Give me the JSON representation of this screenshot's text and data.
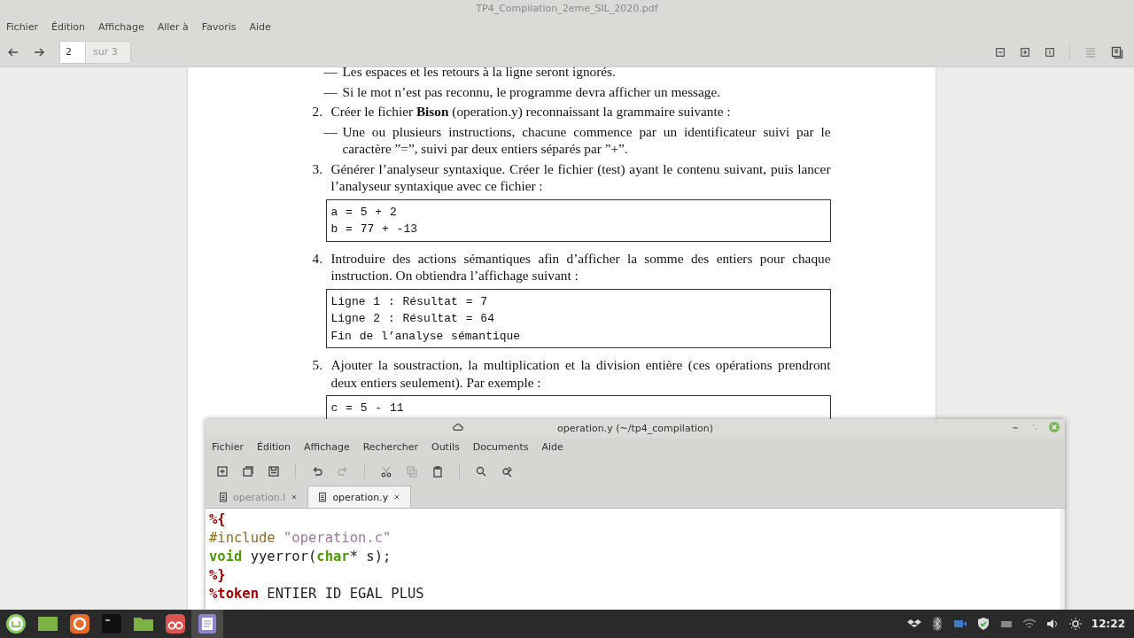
{
  "viewer": {
    "title": "TP4_Compilation_2eme_SIL_2020.pdf",
    "menu": [
      "Fichier",
      "Édition",
      "Affichage",
      "Aller à",
      "Favoris",
      "Aide"
    ],
    "page_number": "2",
    "page_total": "sur 3",
    "blocks": [
      {
        "kind": "dash",
        "marker": "—",
        "text": "Les espaces et les retours à la ligne seront ignorés."
      },
      {
        "kind": "dash",
        "marker": "—",
        "text": "Si le mot n’est pas reconnu, le programme devra afficher un message."
      },
      {
        "kind": "numbered",
        "marker": "2.",
        "text": "Créer le fichier **Bison** (operation.y) reconnaissant la grammaire suivante :"
      },
      {
        "kind": "dash",
        "marker": "—",
        "text": "Une ou plusieurs instructions, chacune commence par un identificateur suivi par le caractère ”=”, suivi par deux entiers séparés par ”+”."
      },
      {
        "kind": "numbered",
        "marker": "3.",
        "text": "Générer l’analyseur syntaxique. Créer le fichier (test) ayant le contenu suivant, puis lancer l’analyseur syntaxique avec ce fichier :"
      },
      {
        "kind": "code",
        "lines": [
          "a = 5 + 2",
          "b = 77 + -13"
        ]
      },
      {
        "kind": "numbered",
        "marker": "4.",
        "text": "Introduire des actions sémantiques afin d’afficher la somme des entiers pour chaque instruction. On obtiendra l’affichage suivant :"
      },
      {
        "kind": "code",
        "lines": [
          "Ligne 1 : Résultat = 7",
          "Ligne 2 : Résultat = 64",
          "Fin de l’analyse sémantique"
        ]
      },
      {
        "kind": "numbered",
        "marker": "5.",
        "text": "Ajouter la soustraction, la multiplication et la division entière (ces opérations prendront deux entiers seulement). Par exemple :"
      },
      {
        "kind": "code",
        "lines": [
          "c = 5 - 11"
        ]
      }
    ]
  },
  "editor": {
    "title": "operation.y (~/tp4_compilation)",
    "menu": [
      "Fichier",
      "Édition",
      "Affichage",
      "Rechercher",
      "Outils",
      "Documents",
      "Aide"
    ],
    "tabs": [
      {
        "label": "operation.l",
        "selected": false
      },
      {
        "label": "operation.y",
        "selected": true
      }
    ],
    "code": [
      [
        {
          "kind": "directive",
          "text": "%{"
        }
      ],
      [
        {
          "kind": "preproc",
          "text": "#include "
        },
        {
          "kind": "string",
          "text": "\"operation.c\""
        }
      ],
      [
        {
          "kind": "type",
          "text": "void"
        },
        {
          "kind": "plain",
          "text": " yyerror("
        },
        {
          "kind": "type",
          "text": "char"
        },
        {
          "kind": "plain",
          "text": "* s);"
        }
      ],
      [
        {
          "kind": "directive",
          "text": "%}"
        }
      ],
      [
        {
          "kind": "directive",
          "text": "%token"
        },
        {
          "kind": "plain",
          "text": " ENTIER ID EGAL PLUS"
        }
      ]
    ]
  },
  "taskbar": {
    "clock": "12:22"
  }
}
